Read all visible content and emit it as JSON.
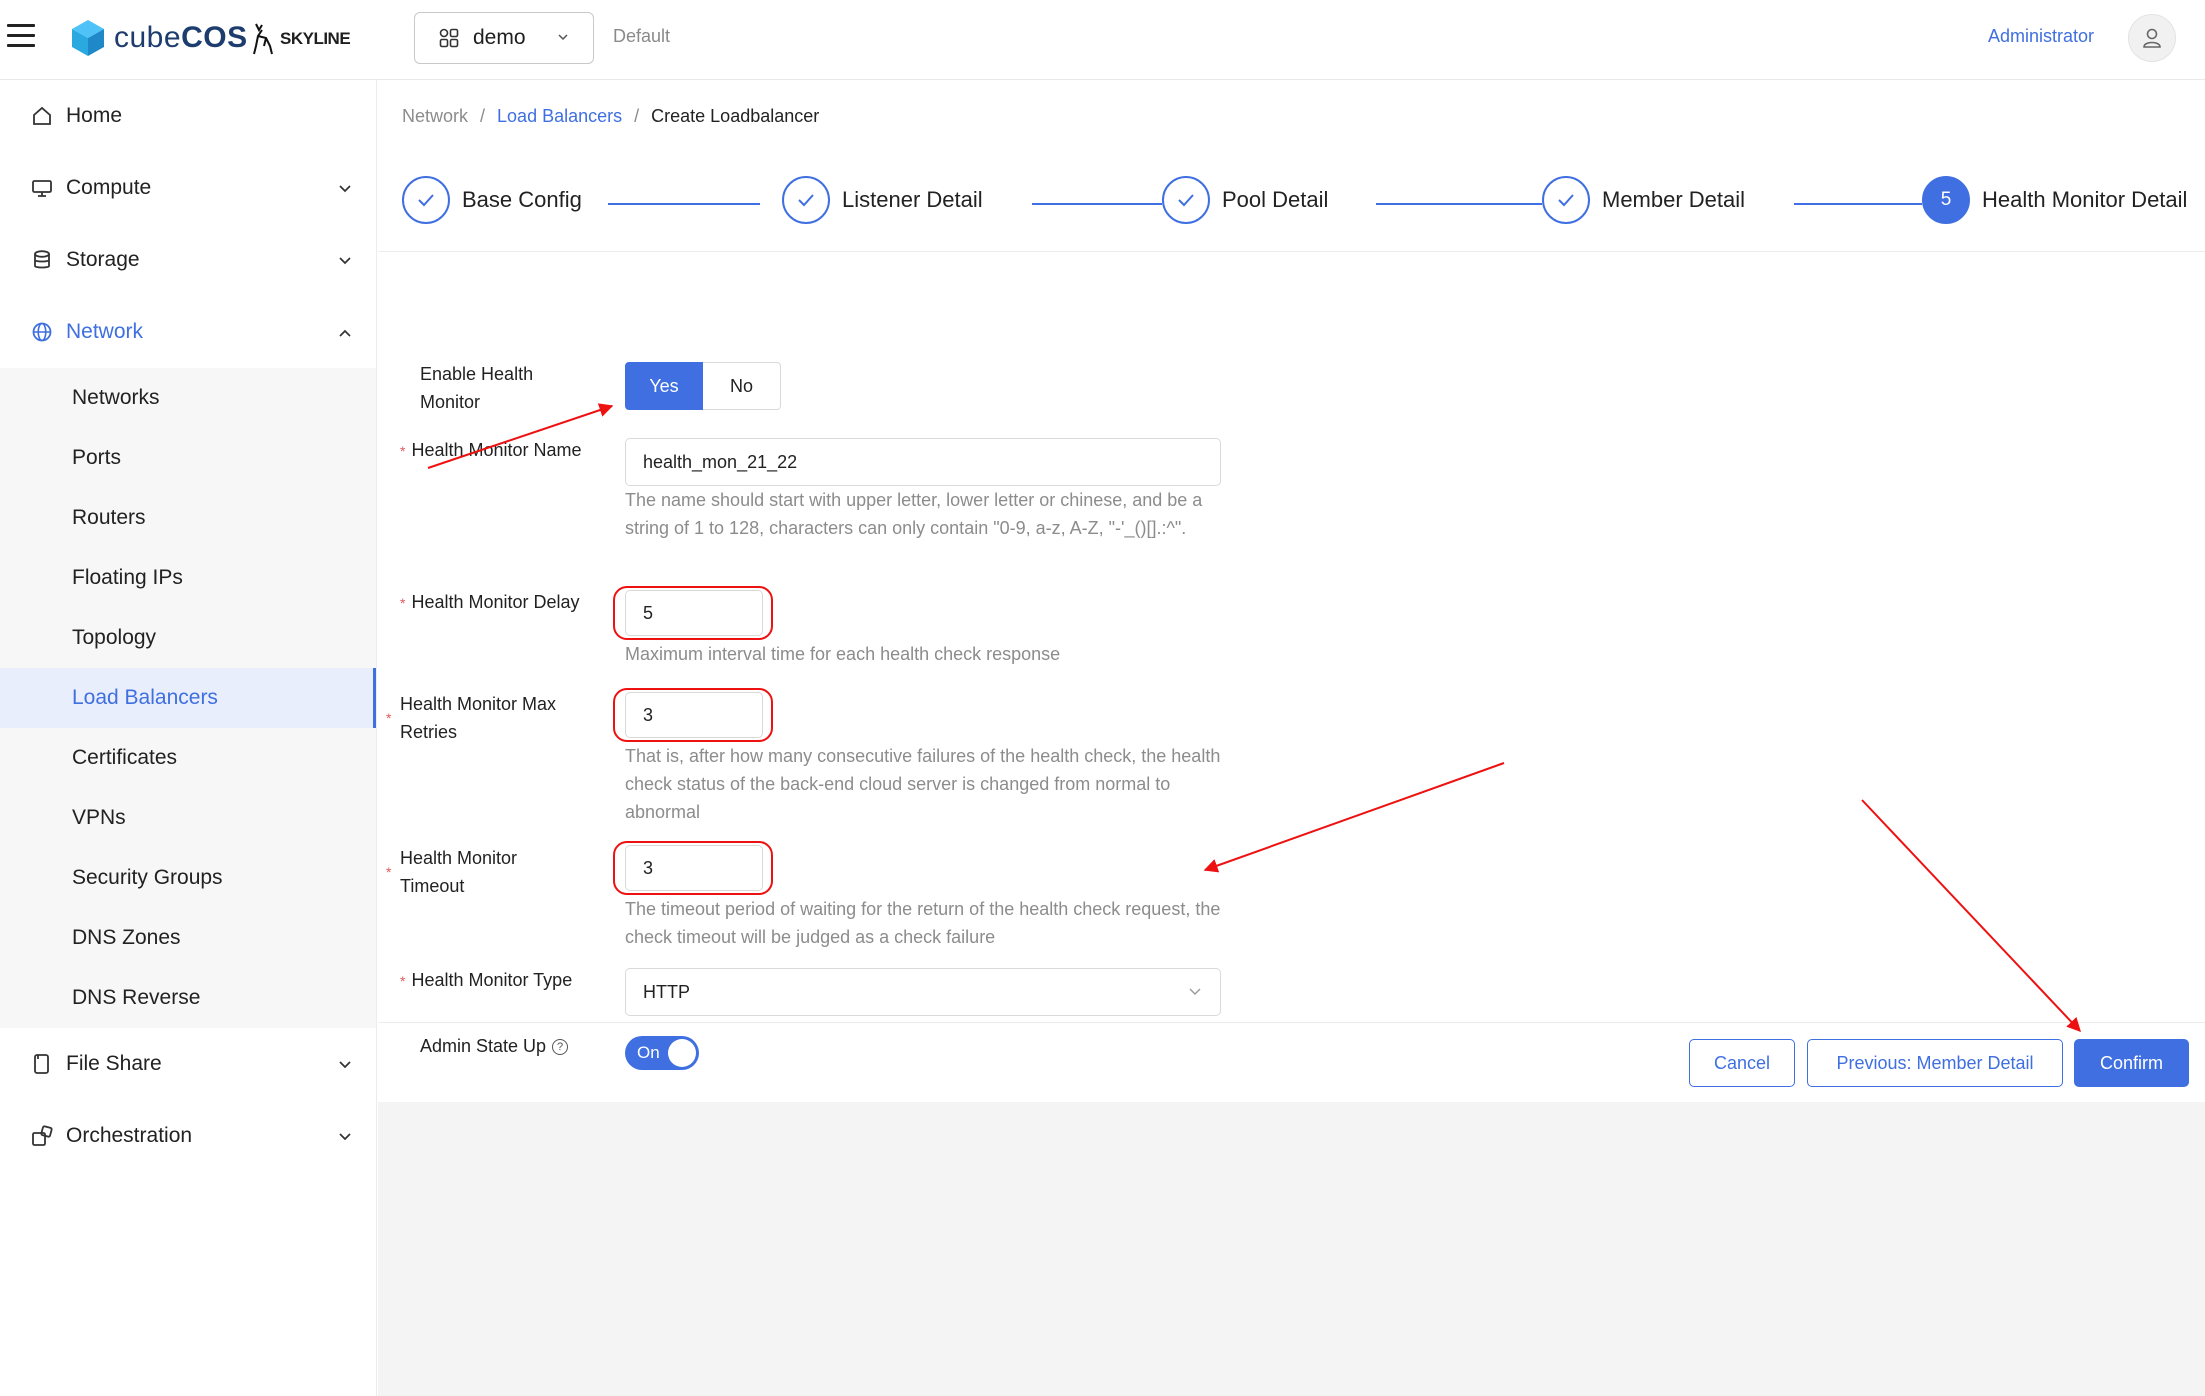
{
  "header": {
    "logo_text_light": "cube",
    "logo_text_bold": "COS",
    "skyline_text": "SKYLINE",
    "project_name": "demo",
    "domain_name": "Default",
    "user_name": "Administrator"
  },
  "sidebar": {
    "home": "Home",
    "compute": "Compute",
    "storage": "Storage",
    "network": "Network",
    "network_items": [
      "Networks",
      "Ports",
      "Routers",
      "Floating IPs",
      "Topology",
      "Load Balancers",
      "Certificates",
      "VPNs",
      "Security Groups",
      "DNS Zones",
      "DNS Reverse"
    ],
    "file_share": "File Share",
    "orchestration": "Orchestration"
  },
  "breadcrumb": {
    "root": "Network",
    "parent": "Load Balancers",
    "current": "Create Loadbalancer",
    "sep": "/"
  },
  "steps": [
    {
      "label": "Base Config",
      "status": "done"
    },
    {
      "label": "Listener Detail",
      "status": "done"
    },
    {
      "label": "Pool Detail",
      "status": "done"
    },
    {
      "label": "Member Detail",
      "status": "done"
    },
    {
      "label": "Health Monitor Detail",
      "status": "current",
      "number": "5"
    }
  ],
  "form": {
    "enable_label_1": "Enable Health",
    "enable_label_2": "Monitor",
    "yes_label": "Yes",
    "no_label": "No",
    "name_label": "Health Monitor Name",
    "name_value": "health_mon_21_22",
    "name_help": "The name should start with upper letter, lower letter or chinese, and be a string of 1 to 128, characters can only contain \"0-9, a-z, A-Z, \"-'_()[].:^\".",
    "delay_label": "Health Monitor Delay",
    "delay_value": "5",
    "delay_help": "Maximum interval time for each health check response",
    "retries_label_1": "Health Monitor Max",
    "retries_label_2": "Retries",
    "retries_value": "3",
    "retries_help": "That is, after how many consecutive failures of the health check, the health check status of the back-end cloud server is changed from normal to abnormal",
    "timeout_label_1": "Health Monitor",
    "timeout_label_2": "Timeout",
    "timeout_value": "3",
    "timeout_help": "The timeout period of waiting for the return of the health check request, the check timeout will be judged as a check failure",
    "type_label": "Health Monitor Type",
    "type_value": "HTTP",
    "admin_label": "Admin State Up",
    "admin_switch": "On",
    "required_mark": "*",
    "help_mark": "?"
  },
  "footer": {
    "cancel": "Cancel",
    "previous": "Previous: Member Detail",
    "confirm": "Confirm"
  },
  "colors": {
    "accent": "#3f6fe0",
    "annotation": "#e11111"
  }
}
